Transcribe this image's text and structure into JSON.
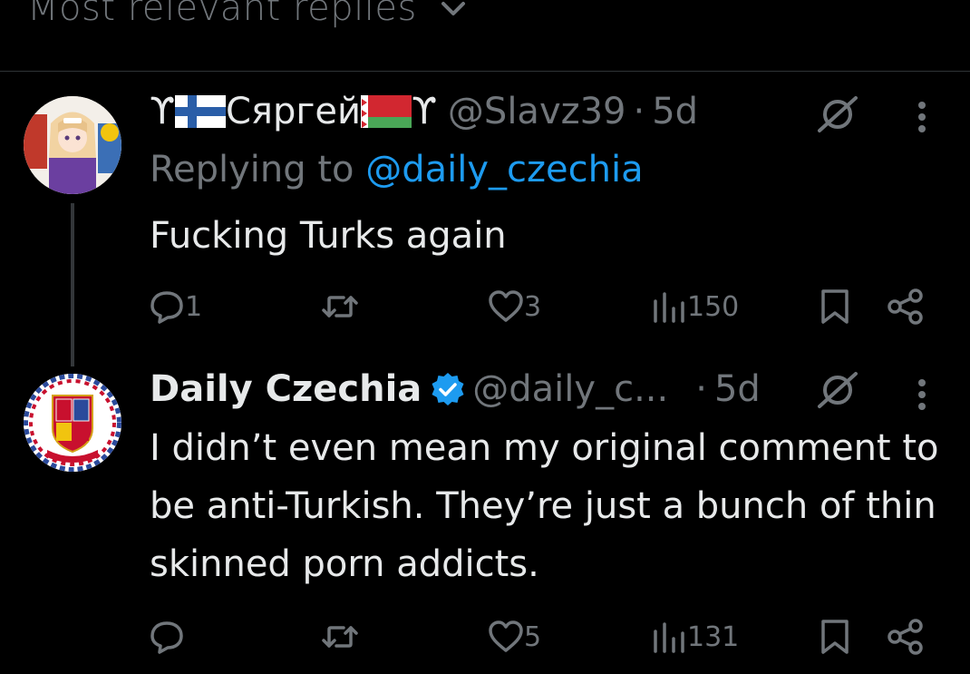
{
  "header": {
    "title": "Most relevant replies"
  },
  "replies": [
    {
      "display_name_prefix": "ϒ",
      "display_name": "Сяргей",
      "display_name_suffix": "ϒ",
      "handle": "@Slavz39",
      "separator": "·",
      "time": "5d",
      "replying_to_label": "Replying to",
      "replying_to_handle": "@daily_czechia",
      "text": "Fucking Turks again",
      "stats": {
        "replies": "1",
        "reposts": "",
        "likes": "3",
        "views": "150"
      }
    },
    {
      "display_name": "Daily Czechia",
      "handle": "@daily_c...",
      "separator": "·",
      "time": "5d",
      "verified": true,
      "text": "I didn’t even mean my original comment to be anti-Turkish. They’re just a bunch of thin skinned porn addicts.",
      "stats": {
        "replies": "",
        "reposts": "",
        "likes": "5",
        "views": "131"
      }
    }
  ],
  "colors": {
    "background": "#000000",
    "text": "#e7e9ea",
    "muted": "#71767b",
    "link": "#1d9bf0",
    "verified": "#1d9bf0",
    "divider": "#2f3336"
  }
}
